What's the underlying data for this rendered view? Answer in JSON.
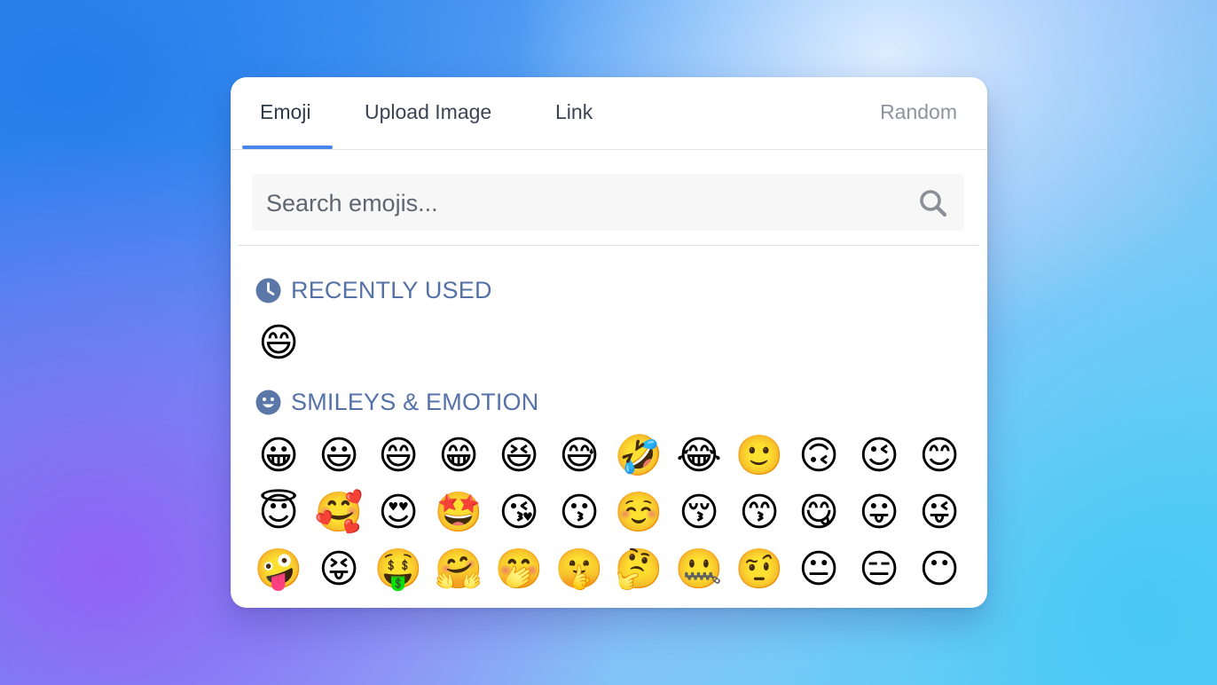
{
  "tabs": {
    "emoji": "Emoji",
    "upload": "Upload Image",
    "link": "Link",
    "random": "Random"
  },
  "search": {
    "placeholder": "Search emojis...",
    "icon": "search-icon"
  },
  "sections": {
    "recent": {
      "title": "RECENTLY USED",
      "icon": "clock-icon",
      "emojis": [
        "😄"
      ]
    },
    "smileys": {
      "title": "SMILEYS & EMOTION",
      "icon": "smiley-icon",
      "rows": [
        [
          "😀",
          "😃",
          "😄",
          "😁",
          "😆",
          "😅",
          "🤣",
          "😂",
          "🙂",
          "🙃",
          "😉",
          "😊"
        ],
        [
          "😇",
          "🥰",
          "😍",
          "🤩",
          "😘",
          "😗",
          "☺️",
          "😚",
          "😙",
          "😋",
          "😛",
          "😜"
        ],
        [
          "🤪",
          "😝",
          "🤑",
          "🤗",
          "🤭",
          "🤫",
          "🤔",
          "🤐",
          "🤨",
          "😐",
          "😑",
          "😶"
        ]
      ]
    }
  },
  "colors": {
    "accent": "#4a86f0",
    "section_title": "#5572a8",
    "section_icon": "#5b77a8"
  }
}
